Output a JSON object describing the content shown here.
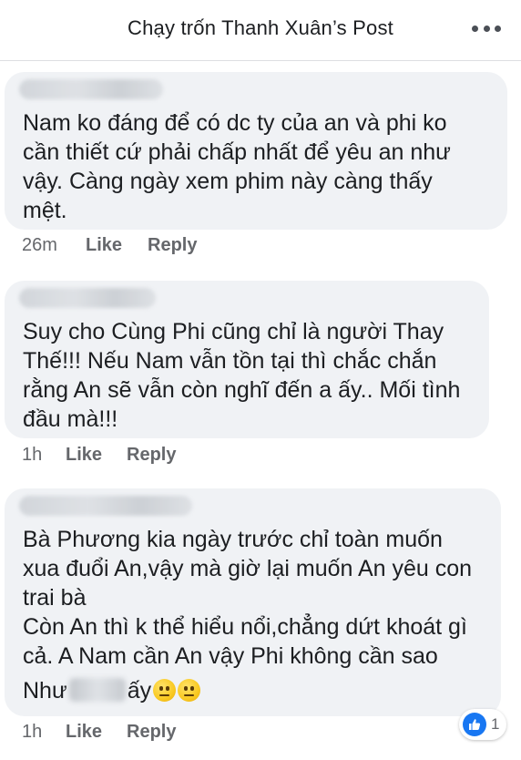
{
  "header": {
    "title": "Chạy trốn Thanh Xuân’s Post"
  },
  "comments": [
    {
      "text": "Nam ko đáng để có dc ty của an và phi ko\ncần thiết cứ phải chấp nhất để yêu an như\nvậy. Càng ngày xem phim này càng thấy\nmệt.",
      "time": "26m",
      "like": "Like",
      "reply": "Reply"
    },
    {
      "text": "Suy cho Cùng Phi cũng chỉ là người Thay\nThế!!! Nếu Nam vẫn tồn tại thì chắc chắn\nrằng An sẽ vẫn còn nghĩ đến a ấy.. Mối tình\nđầu mà!!!",
      "time": "1h",
      "like": "Like",
      "reply": "Reply"
    },
    {
      "text": "Bà Phương kia ngày trước chỉ toàn muốn\nxua đuổi An,vậy mà giờ lại muốn An yêu con\ntrai bà\nCòn An thì k thể hiểu nổi,chẳng dứt khoát gì\ncả. A Nam cần An  vậy Phi không cần sao",
      "last_line_start": "Như",
      "last_line_end": "ấy",
      "time": "1h",
      "like": "Like",
      "reply": "Reply",
      "reaction_count": "1"
    }
  ]
}
